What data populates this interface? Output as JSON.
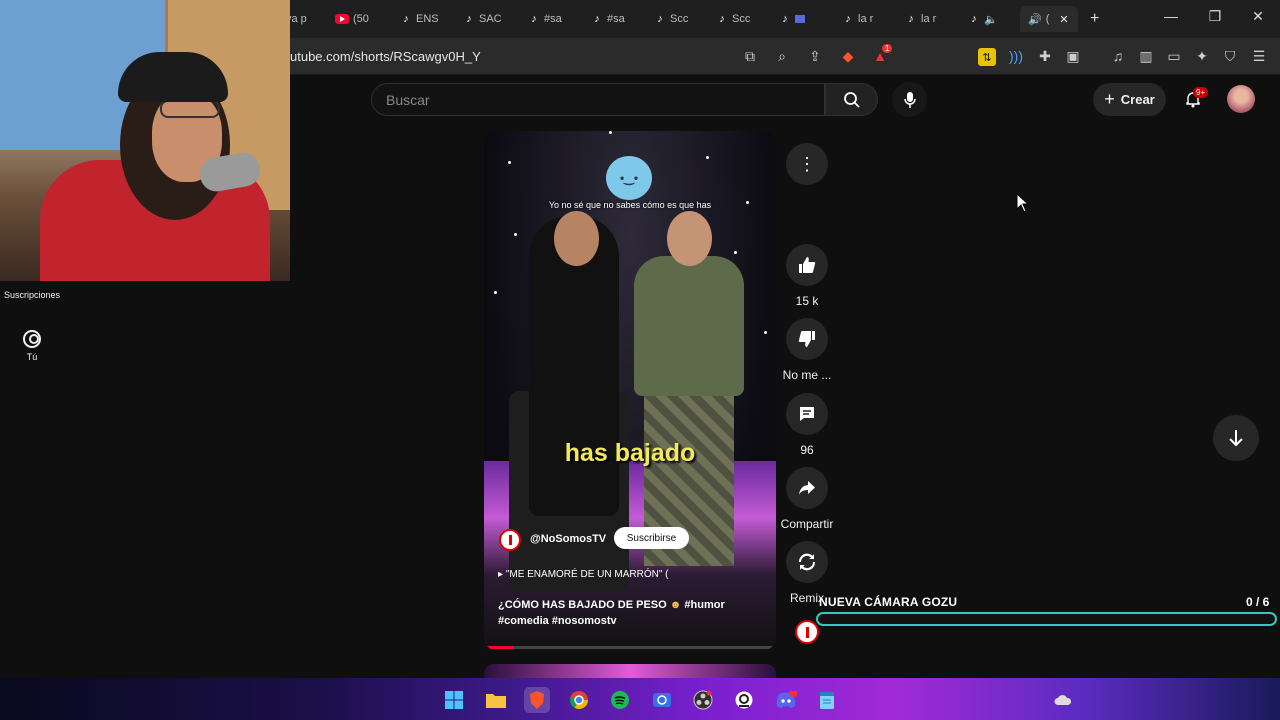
{
  "browser": {
    "tabs": [
      {
        "label": "va p",
        "icon": "none"
      },
      {
        "label": "(50",
        "icon": "youtube-icon"
      },
      {
        "label": "ENS",
        "icon": "tiktok-icon"
      },
      {
        "label": "SAC",
        "icon": "tiktok-icon"
      },
      {
        "label": "#sa",
        "icon": "tiktok-icon"
      },
      {
        "label": "#sa",
        "icon": "tiktok-icon"
      },
      {
        "label": "Scc",
        "icon": "tiktok-icon"
      },
      {
        "label": "Scc",
        "icon": "tiktok-icon"
      },
      {
        "label": "",
        "icon": "tiktok-icon"
      },
      {
        "label": "la r",
        "icon": "tiktok-icon"
      },
      {
        "label": "la r",
        "icon": "tiktok-icon"
      },
      {
        "label": "",
        "icon": "tiktok-icon"
      }
    ],
    "active_tab_label": "(",
    "url": "utube.com/shorts/RScawgv0H_Y",
    "brave_badge": "1"
  },
  "sidebar": {
    "subscriptions_label": "Suscripciones",
    "you_label": "Tú"
  },
  "header": {
    "search_placeholder": "Buscar",
    "create_label": "Crear",
    "notifications_badge": "9+"
  },
  "video": {
    "top_caption": "Yo no sé que no sabes cómo es que has",
    "big_caption": "has bajado",
    "emoji_text": "•‿•",
    "channel": "@NoSomosTV",
    "subscribe_label": "Suscribirse",
    "music": "\"ME ENAMORÉ DE UN MARRÓN\" (",
    "title": "¿CÓMO HAS BAJADO DE PESO",
    "hashtags": "#humor #comedia #nosomostv",
    "progress_fraction": 0.1
  },
  "actions": {
    "like_count": "15 k",
    "dislike_label": "No me ...",
    "comments_count": "96",
    "share_label": "Compartir",
    "remix_label": "Remix"
  },
  "overlay": {
    "goal_title": "NUEVA CÁMARA GOZU",
    "goal_count": "0 / 6",
    "goal_fraction": 0,
    "goal_color": "#35c7c2"
  },
  "colors": {
    "brand_red": "#ff0033",
    "caption_yellow": "#f4e85c"
  }
}
